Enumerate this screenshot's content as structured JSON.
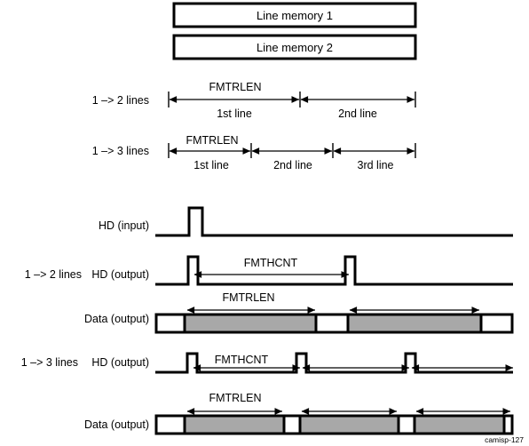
{
  "figure": {
    "caption": "camisp-127",
    "signal_names": {
      "fmtrlen": "FMTRLEN",
      "fmthcnt": "FMTHCNT"
    }
  },
  "memory_boxes": [
    {
      "label": "Line memory 1"
    },
    {
      "label": "Line memory 2"
    }
  ],
  "line_rulers": [
    {
      "row_label": "1 –> 2 lines",
      "span_label": "FMTRLEN",
      "segments": [
        "1st line",
        "2nd line"
      ]
    },
    {
      "row_label": "1 –> 3 lines",
      "span_label": "FMTRLEN",
      "segments": [
        "1st line",
        "2nd line",
        "3rd line"
      ]
    }
  ],
  "waveforms": [
    {
      "row_label": "HD (input)",
      "prefix_label": "",
      "span_label": ""
    },
    {
      "row_label": "HD (output)",
      "prefix_label": "1 –> 2 lines",
      "span_label": "FMTHCNT"
    },
    {
      "row_label": "Data (output)",
      "prefix_label": "",
      "span_label": "FMTRLEN"
    },
    {
      "row_label": "HD (output)",
      "prefix_label": "1 –> 3  lines",
      "span_label": "FMTHCNT"
    },
    {
      "row_label": "Data (output)",
      "prefix_label": "",
      "span_label": "FMTRLEN"
    }
  ],
  "colors": {
    "data_segment_fill": "#a8a8a8",
    "stroke": "#000000",
    "background": "#ffffff"
  }
}
